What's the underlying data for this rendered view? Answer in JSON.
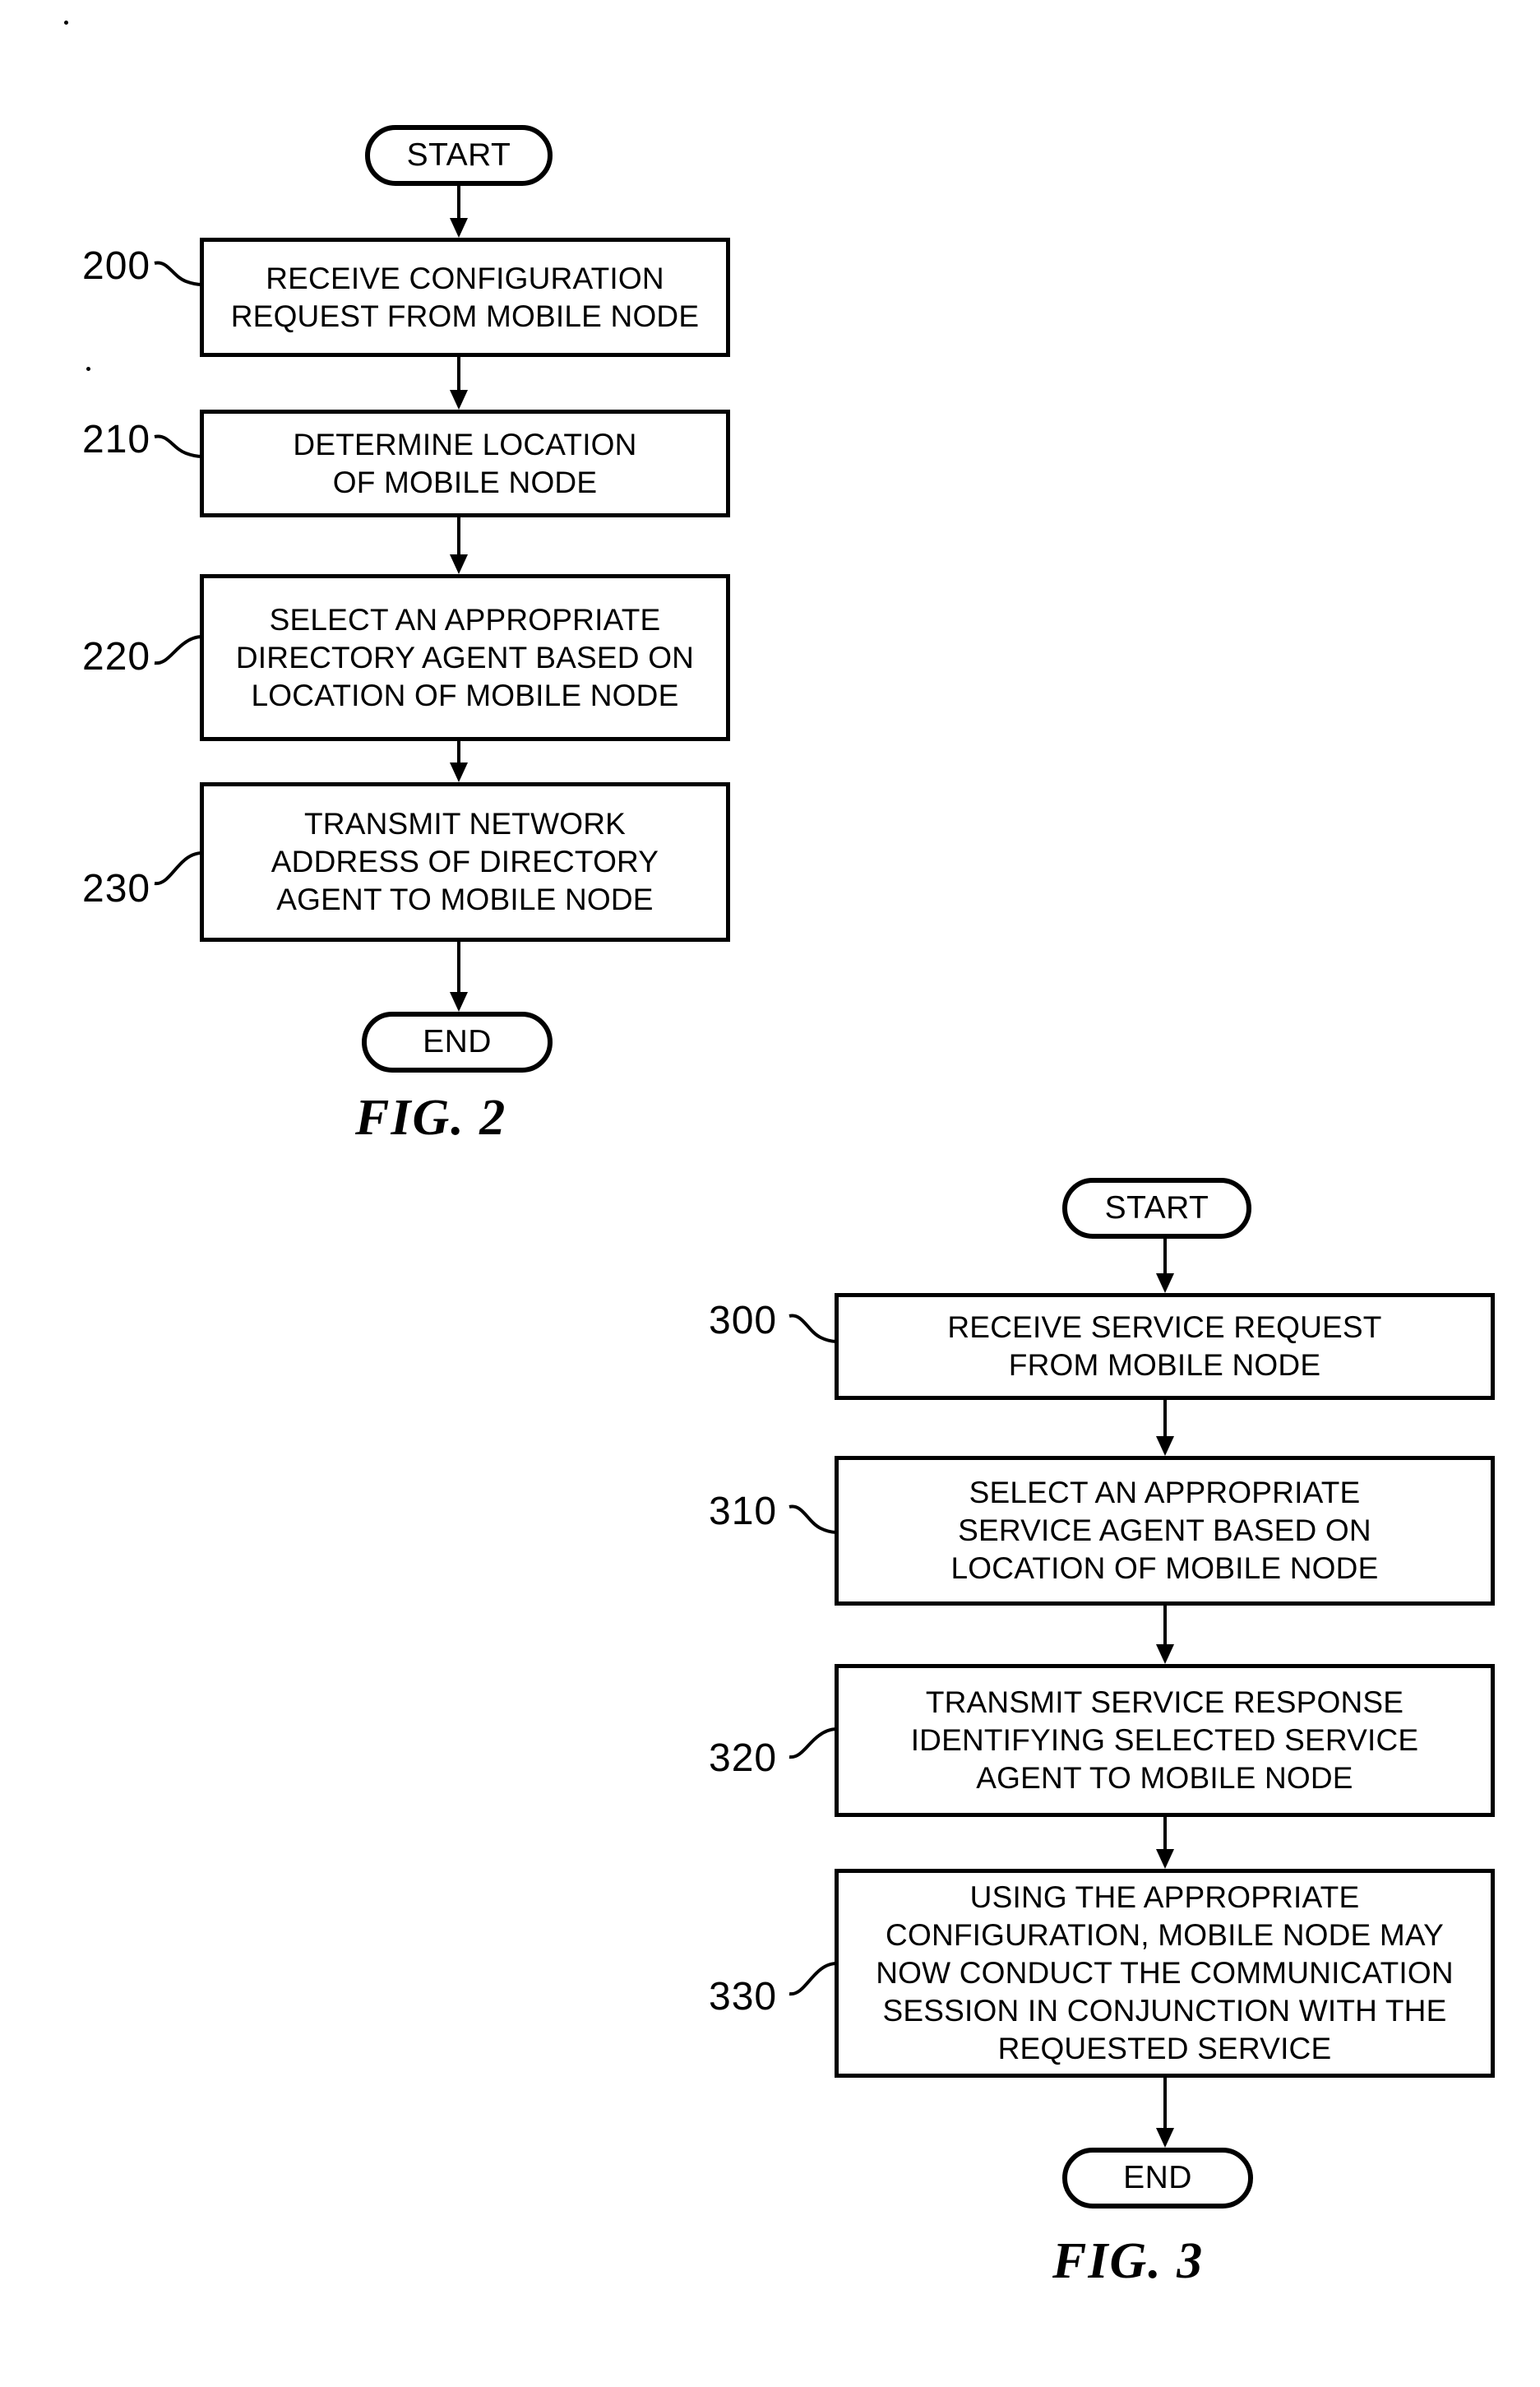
{
  "figures": [
    {
      "id": "fig2",
      "caption": "FIG. 2",
      "start_label": "START",
      "end_label": "END",
      "steps": [
        {
          "ref": "200",
          "lines": [
            "RECEIVE CONFIGURATION",
            "REQUEST FROM MOBILE NODE"
          ]
        },
        {
          "ref": "210",
          "lines": [
            "DETERMINE LOCATION",
            "OF MOBILE NODE"
          ]
        },
        {
          "ref": "220",
          "lines": [
            "SELECT AN APPROPRIATE",
            "DIRECTORY AGENT BASED ON",
            "LOCATION OF MOBILE NODE"
          ]
        },
        {
          "ref": "230",
          "lines": [
            "TRANSMIT NETWORK",
            "ADDRESS OF DIRECTORY",
            "AGENT TO MOBILE NODE"
          ]
        }
      ]
    },
    {
      "id": "fig3",
      "caption": "FIG. 3",
      "start_label": "START",
      "end_label": "END",
      "steps": [
        {
          "ref": "300",
          "lines": [
            "RECEIVE SERVICE REQUEST",
            "FROM MOBILE NODE"
          ]
        },
        {
          "ref": "310",
          "lines": [
            "SELECT AN APPROPRIATE",
            "SERVICE AGENT BASED ON",
            "LOCATION OF MOBILE NODE"
          ]
        },
        {
          "ref": "320",
          "lines": [
            "TRANSMIT SERVICE RESPONSE",
            "IDENTIFYING SELECTED SERVICE",
            "AGENT TO MOBILE NODE"
          ]
        },
        {
          "ref": "330",
          "lines": [
            "USING THE APPROPRIATE",
            "CONFIGURATION, MOBILE NODE MAY",
            "NOW CONDUCT THE COMMUNICATION",
            "SESSION IN CONJUNCTION WITH THE",
            "REQUESTED SERVICE"
          ]
        }
      ]
    }
  ],
  "colors": {
    "ink": "#000000",
    "paper": "#ffffff"
  }
}
